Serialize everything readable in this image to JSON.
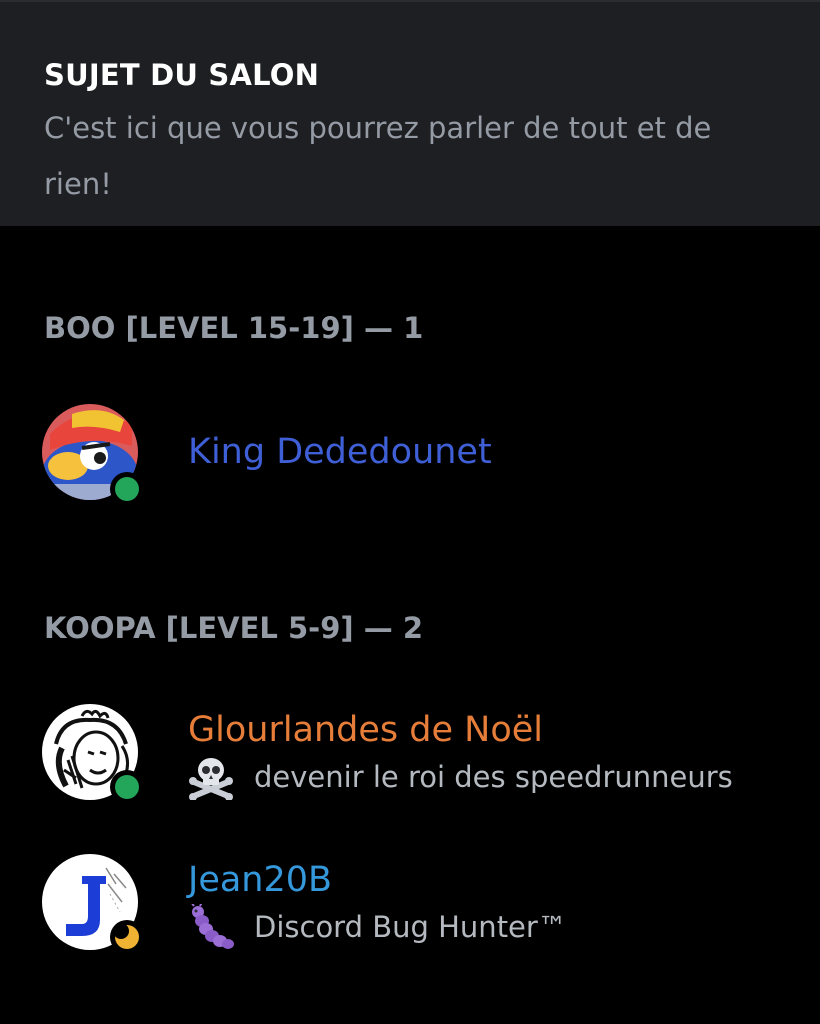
{
  "topic": {
    "title": "SUJET DU SALON",
    "text": "C'est ici que vous pourrez parler de tout et de rien!"
  },
  "sections": [
    {
      "header": "BOO [LEVEL 15-19] — 1",
      "members": [
        {
          "name": "King Dededounet",
          "name_color": "#3f5fd6",
          "status": "online",
          "avatar_icon": "king-dedede-avatar"
        }
      ]
    },
    {
      "header": "KOOPA [LEVEL 5-9] — 2",
      "members": [
        {
          "name": "Glourlandes de Noël",
          "name_color": "#e67e3a",
          "status": "online",
          "avatar_icon": "sheep-drawing-avatar",
          "activity_icon": "skull-crossbones-emoji",
          "activity_text": "devenir le roi des speedrunneurs"
        },
        {
          "name": "Jean20B",
          "name_color": "#3498db",
          "status": "idle",
          "avatar_icon": "letter-j-avatar",
          "activity_icon": "caterpillar-bug-emoji",
          "activity_text": "Discord Bug Hunter™"
        }
      ]
    }
  ],
  "colors": {
    "online": "#23a55a",
    "idle": "#f0b232",
    "background": "#000000",
    "topic_bg": "#1e1f22"
  }
}
